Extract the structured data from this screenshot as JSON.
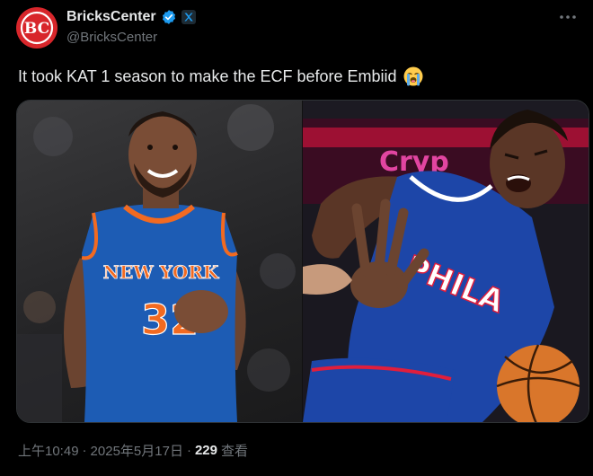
{
  "author": {
    "display_name": "BricksCenter",
    "handle": "@BricksCenter",
    "avatar_text": "BC",
    "verified_icon": "verified-check-icon",
    "badge_icon": "x-affiliate-icon"
  },
  "tweet": {
    "text": "It took KAT 1 season to make the ECF before Embiid",
    "emoji": "loudly-crying-face-icon"
  },
  "media": {
    "left_photo": {
      "subject": "knicks-player-smiling",
      "jersey_text": "NEW YORK",
      "jersey_number": "32"
    },
    "right_photo": {
      "subject": "76ers-player-grimacing",
      "jersey_text": "PHILA",
      "sign_text": "Cryp"
    }
  },
  "footer": {
    "time": "上午10:49",
    "separator": "·",
    "date": "2025年5月17日",
    "views_count": "229",
    "views_label": "查看"
  },
  "colors": {
    "background": "#000000",
    "text_primary": "#e7e9ea",
    "text_secondary": "#71767b",
    "verified": "#1d9bf0",
    "avatar": "#d8262b",
    "knicks_blue": "#1d5cb4",
    "knicks_orange": "#f26a21",
    "sixers_blue": "#1d46a8",
    "sixers_red": "#e01e3c"
  }
}
